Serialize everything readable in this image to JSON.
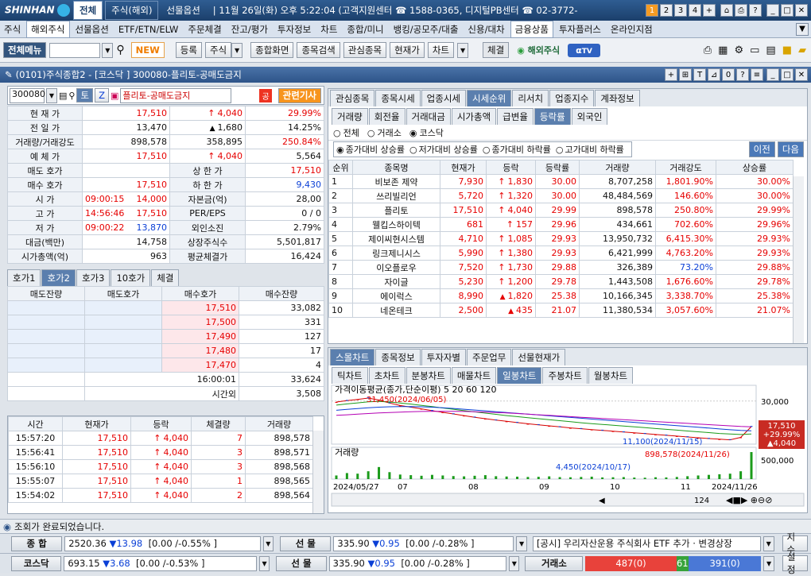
{
  "top": {
    "logo": "SHINHAN",
    "tabs": [
      "전체",
      "주식(해외)",
      "선물옵션"
    ],
    "info": "| 11월 26일(화) 오후 5:22:04 (고객지원센터 ☎ 1588-0365, 디지털PB센터 ☎ 02-3772-",
    "btns": [
      "1",
      "2",
      "3",
      "4",
      "+",
      "⌂",
      "⎙",
      "?",
      "_",
      "□",
      "✕"
    ]
  },
  "menu": [
    "주식",
    "해외주식",
    "선물옵션",
    "ETF/ETN/ELW",
    "주문체결",
    "잔고/평가",
    "투자정보",
    "차트",
    "종합/미니",
    "뱅킹/공모주/대출",
    "신용/대차",
    "금융상품",
    "투자플러스",
    "온라인지점"
  ],
  "toolbar": {
    "all_menu": "전체메뉴",
    "new": "NEW",
    "btns": [
      "등록",
      "주식",
      "종합화면",
      "종목검색",
      "관심종목",
      "현재가",
      "차트"
    ],
    "execution": "체결",
    "overseas": "해외주식",
    "tv": "TV"
  },
  "window": {
    "title": "(0101)주식종합2 - [코스닥 ] 300080-플리토-공매도금지",
    "ctrl": [
      "+",
      "⊞",
      "T",
      "⊿",
      "0",
      "?",
      "≡",
      "_",
      "□",
      "✕"
    ]
  },
  "left": {
    "code": "300080",
    "name": "플리토-공매도금지",
    "related": "관련기사",
    "t": "토",
    "z": "Z",
    "gong": "공",
    "info": [
      {
        "l": "현 재 가",
        "a": "17,510",
        "b": "4,040",
        "c": "29.99%",
        "cls": "red",
        "arrow": "up"
      },
      {
        "l": "전 일 가",
        "a": "13,470",
        "b": "1,680",
        "c": "14.25%",
        "cls": "",
        "arrow": "tri2"
      },
      {
        "l": "거래량/거래강도",
        "a": "898,578",
        "b": "358,895",
        "c": "250.84%",
        "cls": "",
        "arrow": ""
      },
      {
        "l": "예 체 가",
        "a": "17,510",
        "b": "4,040",
        "c": "5,564",
        "cls": "red",
        "arrow": "up"
      }
    ],
    "info2": [
      {
        "l": "매도 호가",
        "a": "",
        "l2": "상 한 가",
        "b": "17,510",
        "cls": "red"
      },
      {
        "l": "매수 호가",
        "a": "17,510",
        "l2": "하 한 가",
        "b": "9,430",
        "cls": "blue"
      }
    ],
    "info3": [
      {
        "l": "시  가",
        "t": "09:00:15",
        "v": "14,000",
        "l2": "자본금(억)",
        "b": "28,00"
      },
      {
        "l": "고  가",
        "t": "14:56:46",
        "v": "17,510",
        "l2": "PER/EPS",
        "b": "0 / 0"
      },
      {
        "l": "저  가",
        "t": "09:00:22",
        "v": "13,870",
        "l2": "외인소진",
        "b": "2.79%"
      }
    ],
    "info4": [
      {
        "l": "대금(백만)",
        "a": "14,758",
        "l2": "상장주식수",
        "b": "5,501,817"
      },
      {
        "l": "시가총액(억)",
        "a": "963",
        "l2": "평균체결가",
        "b": "16,424"
      }
    ],
    "hoga_tabs": [
      "호가1",
      "호가2",
      "호가3",
      "10호가",
      "체결"
    ],
    "hoga_headers": [
      "매도잔량",
      "매도호가",
      "매수호가",
      "매수잔량"
    ],
    "hoga": [
      [
        "17,510",
        "33,082"
      ],
      [
        "17,500",
        "331"
      ],
      [
        "17,490",
        "127"
      ],
      [
        "17,480",
        "17"
      ],
      [
        "17,470",
        "4"
      ]
    ],
    "hoga_time": "16:00:01",
    "hoga_total": "33,624",
    "after_label": "시간외",
    "after_val": "3,508",
    "trade_headers": [
      "시간",
      "현재가",
      "등락",
      "체결량",
      "거래량"
    ],
    "trades": [
      [
        "15:57:20",
        "17,510",
        "4,040",
        "7",
        "898,578"
      ],
      [
        "15:56:41",
        "17,510",
        "4,040",
        "3",
        "898,571"
      ],
      [
        "15:56:10",
        "17,510",
        "4,040",
        "3",
        "898,568"
      ],
      [
        "15:55:07",
        "17,510",
        "4,040",
        "1",
        "898,565"
      ],
      [
        "15:54:02",
        "17,510",
        "4,040",
        "2",
        "898,564"
      ]
    ]
  },
  "right": {
    "tabs": [
      "관심종목",
      "종목시세",
      "업종시세",
      "시세순위",
      "리서치",
      "업종지수",
      "계좌정보"
    ],
    "subtabs": [
      "거래량",
      "회전율",
      "거래대금",
      "시가총액",
      "급변율",
      "등락률",
      "외국인"
    ],
    "market": [
      "전체",
      "거래소",
      "코스닥"
    ],
    "sort": [
      "종가대비 상승률",
      "저가대비 상승률",
      "종가대비 하락률",
      "고가대비 하락률"
    ],
    "prev": "이전",
    "next": "다음",
    "headers": [
      "순위",
      "종목명",
      "현재가",
      "등락",
      "등락률",
      "거래량",
      "거래강도",
      "상승률"
    ],
    "rows": [
      [
        "1",
        "비보존 제약",
        "7,930",
        "1,830",
        "30.00",
        "8,707,258",
        "1,801.90%",
        "30.00%",
        "up"
      ],
      [
        "2",
        "쓰리빌리언",
        "5,720",
        "1,320",
        "30.00",
        "48,484,569",
        "146.60%",
        "30.00%",
        "up"
      ],
      [
        "3",
        "플리토",
        "17,510",
        "4,040",
        "29.99",
        "898,578",
        "250.80%",
        "29.99%",
        "up"
      ],
      [
        "4",
        "웰킵스하이텍",
        "681",
        "157",
        "29.96",
        "434,661",
        "702.60%",
        "29.96%",
        "up"
      ],
      [
        "5",
        "제이씨현시스템",
        "4,710",
        "1,085",
        "29.93",
        "13,950,732",
        "6,415.30%",
        "29.93%",
        "up"
      ],
      [
        "6",
        "링크제니시스",
        "5,990",
        "1,380",
        "29.93",
        "6,421,999",
        "4,763.20%",
        "29.93%",
        "up"
      ],
      [
        "7",
        "이오플로우",
        "7,520",
        "1,730",
        "29.88",
        "326,389",
        "73.20%",
        "29.88%",
        "up"
      ],
      [
        "8",
        "자이글",
        "5,230",
        "1,200",
        "29.78",
        "1,443,508",
        "1,676.60%",
        "29.78%",
        "up"
      ],
      [
        "9",
        "에이럭스",
        "8,990",
        "1,820",
        "25.38",
        "10,166,345",
        "3,338.70%",
        "25.38%",
        "tri"
      ],
      [
        "10",
        "네온테크",
        "2,500",
        "435",
        "21.07",
        "11,380,534",
        "3,057.60%",
        "21.07%",
        "tri"
      ]
    ],
    "chart_tabs": [
      "스몰차트",
      "종목정보",
      "투자자별",
      "주문업무",
      "선물현재가"
    ],
    "chart_subtabs": [
      "틱차트",
      "초차트",
      "분봉차트",
      "매물차트",
      "일봉차트",
      "주봉차트",
      "월봉차트"
    ]
  },
  "chart_data": {
    "type": "line",
    "title": "가격이동평균(종가,단순이평) 5 20 60 120",
    "x_ticks": [
      "2024/05/27",
      "07",
      "08",
      "09",
      "10",
      "11",
      "2024/11/26"
    ],
    "y_ticks": [
      "30,000"
    ],
    "annotations": [
      "31,450(2024/06/05)",
      "11,100(2024/11/15)",
      "898,578(2024/11/26)",
      "4,450(2024/10/17)"
    ],
    "last_price": "17,510",
    "last_pct": "+29.99%",
    "last_chg": "4,040",
    "volume_label": "거래량",
    "volume_tick": "500,000",
    "zoom": "124",
    "series": [
      {
        "name": "5",
        "color": "#d40000",
        "values": [
          29500,
          30200,
          30800,
          31450,
          30500,
          29000,
          27800,
          27000,
          26200,
          25300,
          24500,
          23700,
          22900,
          22100,
          21400,
          20700,
          20100,
          19500,
          18900,
          18400,
          17900,
          17400,
          16900,
          16500,
          16100,
          15700,
          15300,
          14900,
          14500,
          14100,
          13700,
          13300,
          12900,
          12500,
          12100,
          11700,
          11400,
          11100,
          12300,
          17510
        ]
      },
      {
        "name": "20",
        "color": "#1b9b1b",
        "values": [
          28000,
          28600,
          29100,
          29600,
          29800,
          29500,
          29000,
          28500,
          27900,
          27300,
          26600,
          26000,
          25300,
          24700,
          24100,
          23500,
          22900,
          22400,
          21900,
          21400,
          20900,
          20400,
          19900,
          19400,
          19000,
          18600,
          18200,
          17800,
          17400,
          17000,
          16600,
          16200,
          15800,
          15400,
          15000,
          14600,
          14200,
          13900,
          13700,
          13900
        ]
      },
      {
        "name": "60",
        "color": "#0a3fd6",
        "values": [
          25500,
          25900,
          26300,
          26700,
          27000,
          27200,
          27300,
          27300,
          27200,
          27000,
          26700,
          26400,
          26000,
          25600,
          25200,
          24800,
          24400,
          24000,
          23600,
          23200,
          22800,
          22400,
          22000,
          21600,
          21200,
          20800,
          20400,
          20000,
          19600,
          19200,
          18800,
          18400,
          18000,
          17600,
          17200,
          16800,
          16400,
          16000,
          15700,
          15500
        ]
      },
      {
        "name": "120",
        "color": "#b400b4",
        "values": [
          23000,
          23300,
          23600,
          23900,
          24200,
          24400,
          24600,
          24800,
          24900,
          25000,
          25000,
          25000,
          24900,
          24800,
          24600,
          24400,
          24200,
          23900,
          23600,
          23300,
          23000,
          22700,
          22400,
          22100,
          21800,
          21500,
          21200,
          20900,
          20600,
          20300,
          20000,
          19700,
          19400,
          19100,
          18800,
          18500,
          18200,
          17900,
          17600,
          17400
        ]
      }
    ],
    "volume": [
      120,
      200,
      180,
      260,
      400,
      230,
      150,
      130,
      110,
      140,
      120,
      100,
      90,
      110,
      130,
      95,
      85,
      80,
      70,
      75,
      90,
      65,
      60,
      70,
      80,
      55,
      60,
      65,
      50,
      45,
      60,
      55,
      70,
      95,
      120,
      140,
      160,
      180,
      260,
      898
    ]
  },
  "status": {
    "msg": "조회가 완료되었습니다."
  },
  "ticker1": {
    "label": "종  합",
    "v": "2520.36",
    "chg": "13.98",
    "rng": "[0.00  /-0.55%  ]",
    "label2": "선  물",
    "v2": "335.90",
    "chg2": "0.95",
    "rng2": "[0.00  /-0.28%  ]",
    "notice": "[공시] 우리자산운용 주식회사 ETF 추가 · 변경상장",
    "btn": "지수"
  },
  "ticker2": {
    "label": "코스닥",
    "v": "693.15",
    "chg": "3.68",
    "rng": "[0.00  /-0.53%  ]",
    "label2": "선  물",
    "v2": "335.90",
    "chg2": "0.95",
    "rng2": "[0.00  /-0.28%  ]",
    "ex": "거래소",
    "a": "487(0)",
    "b": "61",
    "c": "391(0)",
    "btn": "설정"
  },
  "colors": {
    "up": "#e60000",
    "down": "#0a3fd6",
    "accent": "#2e5489"
  }
}
